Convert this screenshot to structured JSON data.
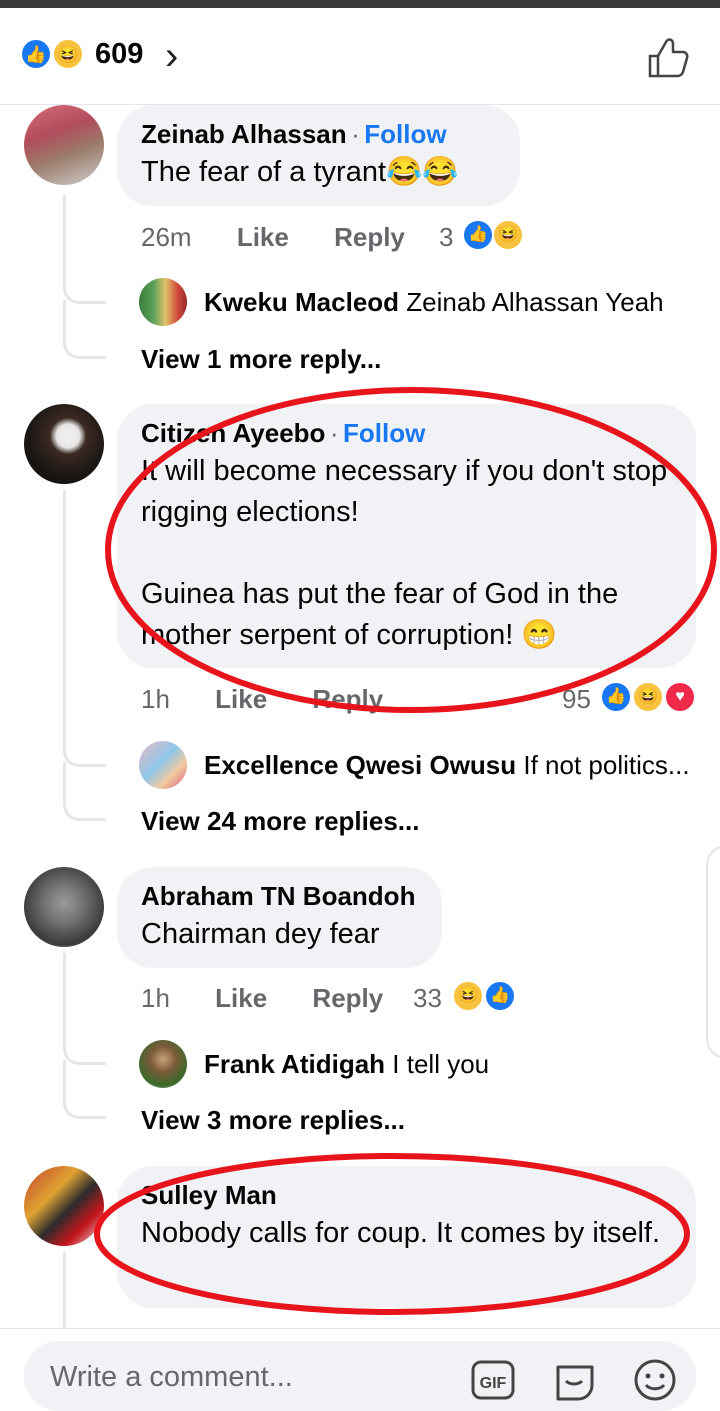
{
  "header": {
    "reaction_count": "609",
    "reactions": [
      "like-icon",
      "haha-icon"
    ]
  },
  "comments": [
    {
      "author": "Zeinab Alhassan",
      "separator": "·",
      "follow": "Follow",
      "text": "The fear of a tyrant😂😂",
      "time": "26m",
      "like": "Like",
      "reply": "Reply",
      "reaction_count": "3",
      "reply_preview": {
        "author": "Kweku Macleod",
        "text": "Zeinab Alhassan Yeah"
      },
      "more": "View 1 more reply..."
    },
    {
      "author": "Citizen Ayeebo",
      "separator": "·",
      "follow": "Follow",
      "text": "It will become necessary if you don't stop rigging elections!\n\nGuinea has put the fear of God in the mother serpent of corruption! 😁",
      "time": "1h",
      "like": "Like",
      "reply": "Reply",
      "reaction_count": "95",
      "reply_preview": {
        "author": "Excellence Qwesi Owusu",
        "text": "If not politics..."
      },
      "more": "View 24 more replies..."
    },
    {
      "author": "Abraham TN Boandoh",
      "text": "Chairman dey fear",
      "time": "1h",
      "like": "Like",
      "reply": "Reply",
      "reaction_count": "33",
      "reply_preview": {
        "author": "Frank Atidigah",
        "text": "I tell you"
      },
      "more": "View 3 more replies..."
    },
    {
      "author": "Sulley Man",
      "text": "Nobody calls for coup. It comes by itself."
    }
  ],
  "composer": {
    "placeholder": "Write a comment...",
    "gif_label": "GIF"
  },
  "colors": {
    "accent": "#1877f2",
    "annotation": "#e8141c",
    "bubble": "#f0f2f5"
  }
}
